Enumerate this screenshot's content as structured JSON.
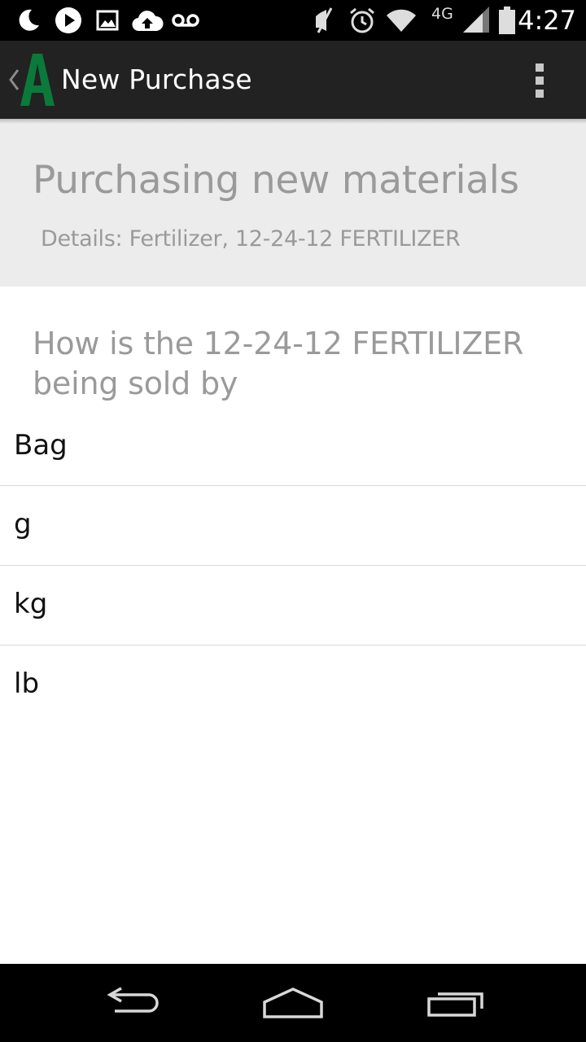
{
  "status_bar": {
    "time": "4:27",
    "network_label": "4G",
    "left_icons": [
      "moon-icon",
      "play-icon",
      "image-icon",
      "cloud-upload-icon",
      "voicemail-icon"
    ],
    "right_icons": [
      "mute-icon",
      "alarm-icon",
      "wifi-icon",
      "signal-icon",
      "battery-icon"
    ]
  },
  "action_bar": {
    "title": "New Purchase",
    "logo_letter": "A",
    "logo_color": "#0a7a3a",
    "background": "#222222"
  },
  "header": {
    "title": "Purchasing new materials",
    "details": "Details: Fertilizer, 12-24-12 FERTILIZER"
  },
  "question": {
    "text": "How is the 12-24-12 FERTILIZER being sold by"
  },
  "options": [
    {
      "label": "Bag"
    },
    {
      "label": "g"
    },
    {
      "label": "kg"
    },
    {
      "label": "lb"
    }
  ],
  "nav_bar": {
    "buttons": [
      "back-icon",
      "home-icon",
      "recent-apps-icon"
    ]
  }
}
